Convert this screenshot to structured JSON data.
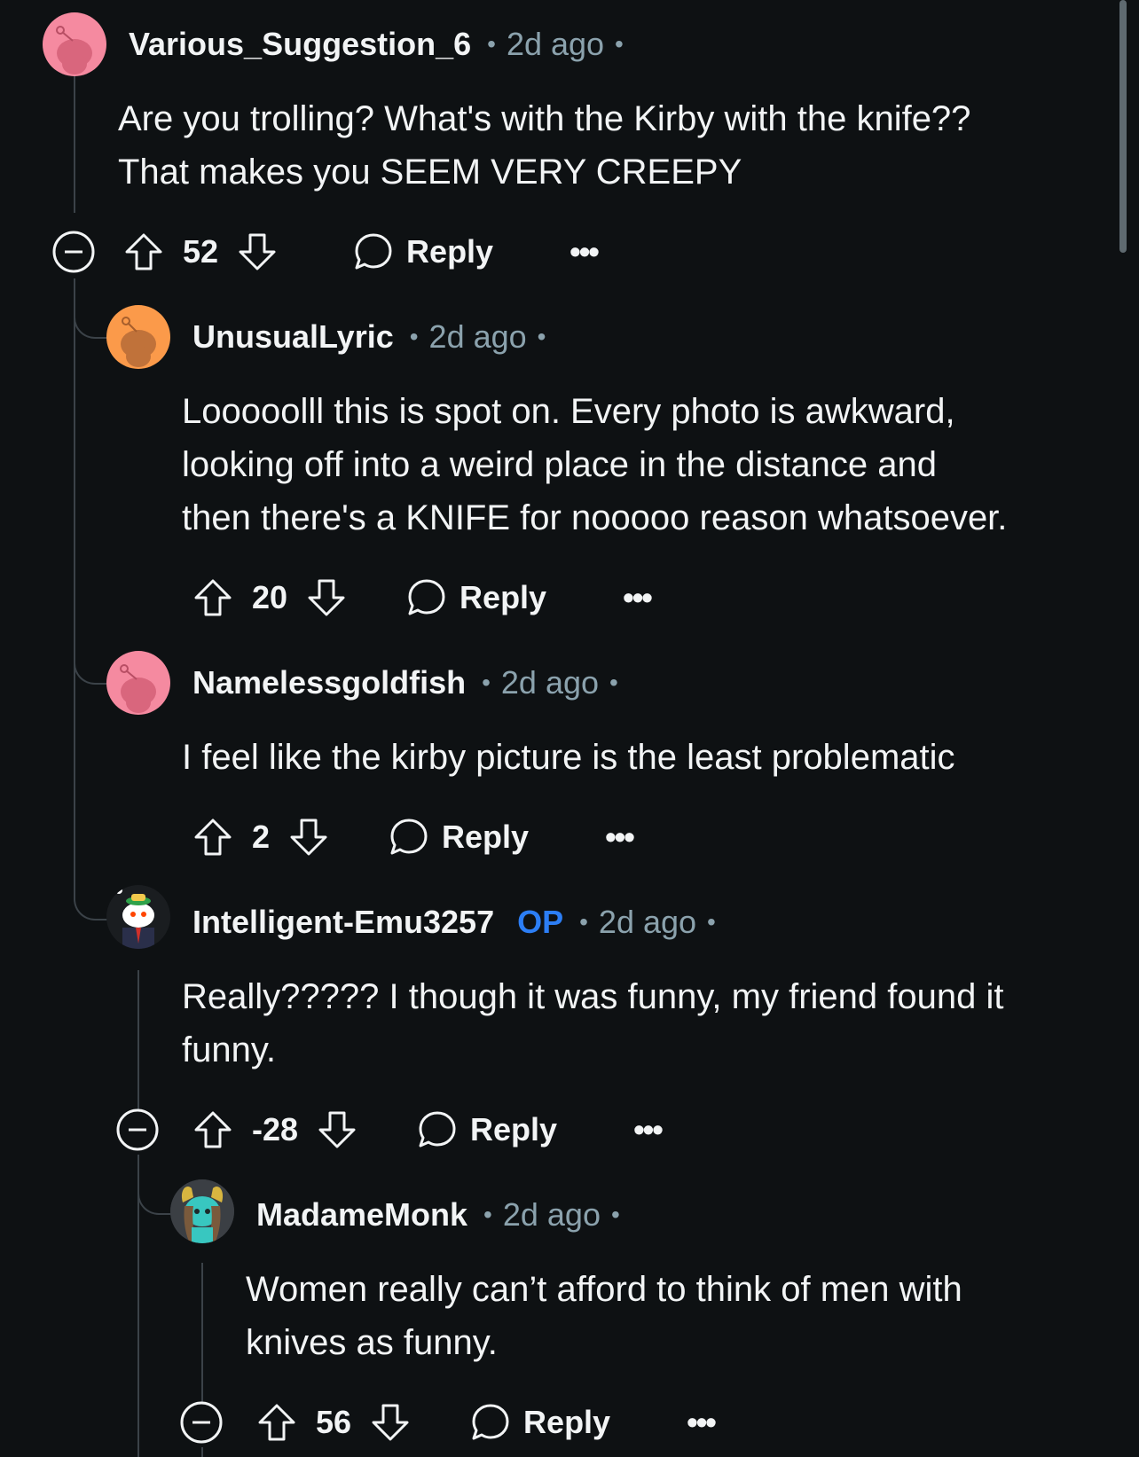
{
  "comments": [
    {
      "user": "Various_Suggestion_6",
      "time": "2d ago",
      "lines": [
        "Are you trolling? What's with the Kirby with the knife??",
        "That makes you SEEM VERY CREEPY"
      ],
      "score": "52",
      "reply": "Reply",
      "avatar": "pink-snoo-avatar"
    },
    {
      "user": "UnusualLyric",
      "time": "2d ago",
      "lines": [
        "Looooolll this is spot on. Every photo is awkward,",
        "looking off into a weird place in the distance and",
        "then there's a KNIFE for nooooo reason whatsoever."
      ],
      "score": "20",
      "reply": "Reply",
      "avatar": "orange-snoo-avatar"
    },
    {
      "user": "Namelessgoldfish",
      "time": "2d ago",
      "lines": [
        "I feel like the kirby picture is the least problematic"
      ],
      "score": "2",
      "reply": "Reply",
      "avatar": "pink-snoo-avatar"
    },
    {
      "user": "Intelligent-Emu3257",
      "op": "OP",
      "time": "2d ago",
      "lines": [
        "Really????? I though it was funny, my friend found it",
        "funny."
      ],
      "score": "-28",
      "reply": "Reply",
      "avatar": "snoo-suit-avatar"
    },
    {
      "user": "MadameMonk",
      "time": "2d ago",
      "lines": [
        "Women really can’t afford to think of men with",
        "knives as funny."
      ],
      "score": "56",
      "reply": "Reply",
      "avatar": "teal-snoo-avatar"
    }
  ],
  "icons": {
    "collapse": "collapse-icon",
    "upvote": "upvote-icon",
    "downvote": "downvote-icon",
    "reply": "reply-bubble-icon",
    "more": "more-icon"
  },
  "more_glyph": "•••",
  "dot_glyph": "•",
  "colors": {
    "background": "#0e1113",
    "text": "#f2f4f5",
    "meta": "#8ba2ad",
    "op": "#2c7ef5",
    "thread_line": "#3b4248"
  }
}
